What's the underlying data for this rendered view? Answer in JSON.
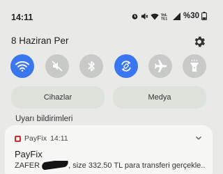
{
  "status_bar": {
    "time": "14:11",
    "battery_percent": "%30",
    "icons": [
      "alarm-icon",
      "mute-icon",
      "wifi-icon",
      "volte-icon",
      "signal-icon",
      "battery-icon"
    ]
  },
  "header": {
    "date": "8 Haziran Per",
    "settings_icon": "gear-icon"
  },
  "quick_settings": [
    {
      "name": "wifi",
      "icon": "wifi-icon",
      "on": true
    },
    {
      "name": "sound",
      "icon": "mute-icon",
      "on": false
    },
    {
      "name": "bluetooth",
      "icon": "bluetooth-icon",
      "on": false
    },
    {
      "name": "auto-rotate",
      "icon": "rotate-icon",
      "on": true
    },
    {
      "name": "airplane-mode",
      "icon": "airplane-icon",
      "on": false
    },
    {
      "name": "flashlight",
      "icon": "flashlight-icon",
      "on": false
    }
  ],
  "media_row": {
    "devices_label": "Cihazlar",
    "media_label": "Medya"
  },
  "alerts": {
    "section_title": "Uyarı bildirimleri"
  },
  "notification": {
    "app_name": "PayFix",
    "time": "14:11",
    "title": "PayFix",
    "body_prefix": "ZAFER",
    "body_suffix": ", size 332.50 TL para transferi gerçekle.."
  },
  "colors": {
    "accent": "#3a76f0",
    "tile_off": "#c8cac8",
    "background": "#e9eae7",
    "card": "#f7f8f6",
    "app_icon": "#d8272f"
  }
}
